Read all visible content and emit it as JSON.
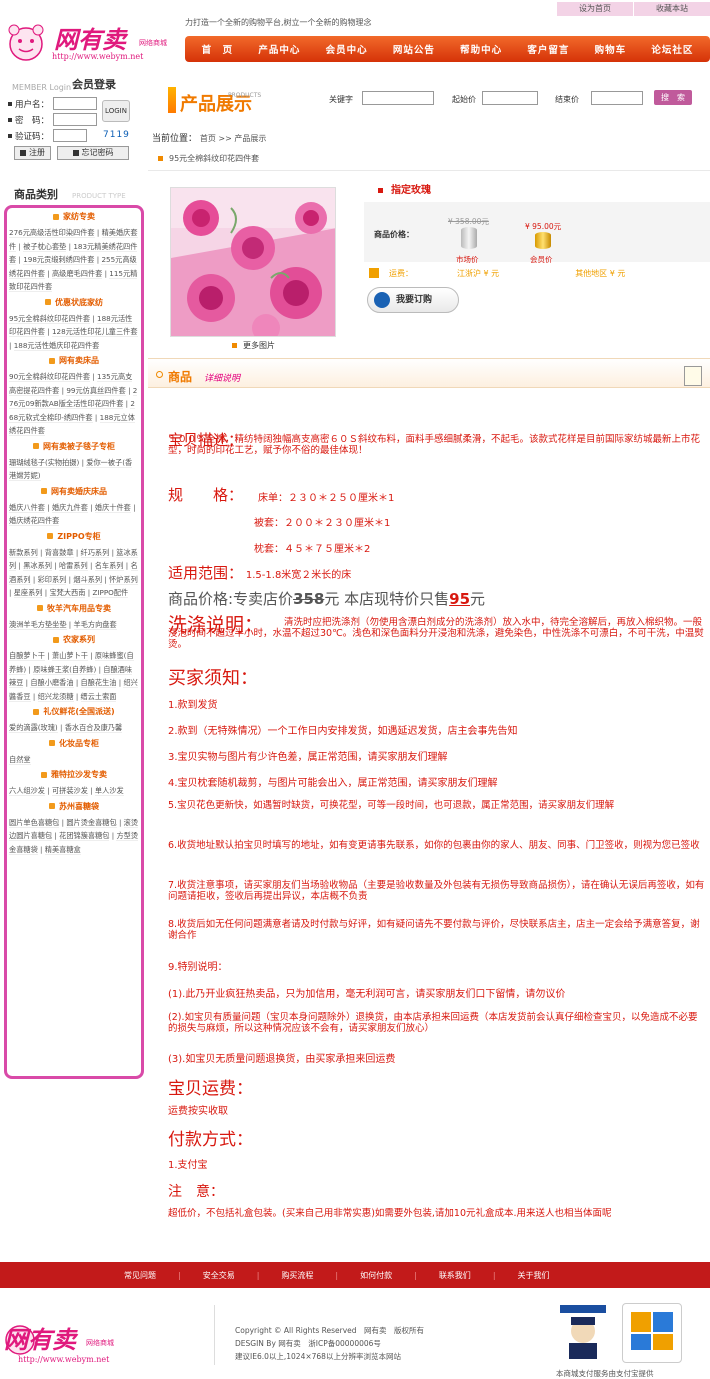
{
  "brand": {
    "name": "网有卖",
    "sub": "网络商城",
    "url": "http://www.webym.net",
    "slogan": "力打造一个全新的购物平台,树立一个全新的购物理念"
  },
  "top_links": [
    "设为首页",
    "收藏本站"
  ],
  "nav": [
    "首　页",
    "产品中心",
    "会员中心",
    "网站公告",
    "帮助中心",
    "客户留言",
    "购物车",
    "论坛社区"
  ],
  "login": {
    "title_en": "MEMBER Login",
    "title": "会员登录",
    "username_label": "用户名：",
    "password_label": "密　码：",
    "captcha_label": "验证码：",
    "captcha_value": "7119",
    "login_button": "LOGIN",
    "register_button": "注册",
    "forgot_button": "忘记密码"
  },
  "categories": {
    "title": "商品类别",
    "title_en": "PRODUCT TYPE",
    "sections": [
      {
        "name": "家纺专卖",
        "items": [
          "276元高级活性印染四件套",
          "精美婚庆套件",
          "被子枕心套垫",
          "183元精美绣花四件套",
          "198元贡缎刺绣四件套",
          "255元高级绣花四件套",
          "高级磨毛四件套",
          "115元精致印花四件套"
        ]
      },
      {
        "name": "优惠状底家纺",
        "items": [
          "95元全棉斜纹印花四件套",
          "188元活性印花四件套",
          "128元活性印花儿童三件套",
          "188元活性婚庆印花四件套"
        ]
      },
      {
        "name": "网有卖床品",
        "items": [
          "90元全棉斜纹印花四件套",
          "135元高支高密提花四件套",
          "99元仿真丝四件套",
          "276元09新款AB版全活性印花四件套",
          "268元软式全棉印-绣四件套",
          "188元立体绣花四件套"
        ]
      },
      {
        "name": "网有卖被子毯子专柜",
        "items": [
          "珊瑚绒毯子(实物拍摄)",
          "爱你一被子(香港嫦芳妮)"
        ]
      },
      {
        "name": "网有卖婚庆床品",
        "items": [
          "婚庆八件套",
          "婚庆九件套",
          "婚庆十件套",
          "婚庆绣花四件套"
        ]
      },
      {
        "name": "ZIPPO专柜",
        "items": [
          "新款系列",
          "背喜鼓章",
          "纤巧系列",
          "篮冰系列",
          "黑冰系列",
          "哈雷系列",
          "名车系列",
          "名酒系列",
          "彩印系列",
          "烟斗系列",
          "怀炉系列",
          "星座系列",
          "宝梵大西南",
          "ZIPPO配件"
        ]
      },
      {
        "name": "牧羊汽车用品专卖",
        "items": [
          "澳洲羊毛方垫坐垫",
          "羊毛方向盘套"
        ]
      },
      {
        "name": "农家系列",
        "items": [
          "自酿萝卜干",
          "萧山萝卜干",
          "原味蜂蜜(自养蜂)",
          "原味蜂王浆(自养蜂)",
          "自酿酒味辣豆",
          "自酿小磨香油",
          "自酿花生油",
          "绍兴醬香豆",
          "绍兴龙须糖",
          "缙云土索面"
        ]
      },
      {
        "name": "礼仪鲜花(全国派送)",
        "items": [
          "爱的滴露(玫瑰)",
          "香水百合及康乃馨"
        ]
      },
      {
        "name": "化妆品专柜",
        "items": [
          "自然堂"
        ]
      },
      {
        "name": "雅特拉沙发专卖",
        "items": [
          "六人组沙发",
          "可拼装沙发",
          "单人沙发"
        ]
      },
      {
        "name": "苏州喜糖袋",
        "items": [
          "圆片单色喜糖包",
          "圆片烫金喜糖包",
          "滚烫边圆片喜糖包",
          "花团锦簇喜糖包",
          "方型烫金喜糖袋",
          "精美喜糖盒"
        ]
      }
    ]
  },
  "product_header": {
    "title": "产品展示",
    "title_en": "PRODUCTS",
    "keyword_label": "关键字",
    "start_price_label": "起始价",
    "end_price_label": "结束价",
    "search_button": "搜　索"
  },
  "breadcrumb": {
    "label": "当前位置：",
    "path": "首页 >> 产品展示"
  },
  "product": {
    "name": "95元全棉斜纹印花四件套",
    "more_pics": "更多图片",
    "custom_title": "指定玫瑰",
    "price_label": "商品价格：",
    "market_price": "¥ 358.00元",
    "market_label": "市场价",
    "member_price": "¥ 95.00元",
    "member_label": "会员价",
    "ship_label": "运费：",
    "ship_local": "江浙沪 ¥ 元",
    "ship_other": "其他地区 ¥ 元",
    "order_button": "我要订购"
  },
  "detail_header": {
    "title": "商品",
    "sub": "详细说明"
  },
  "description": {
    "desc_title": "宝贝描述：",
    "desc_text": "１００％全棉，精纺特阔独幅高支高密６０Ｓ斜纹布料，面料手感细腻柔滑，不起毛。该款式花样是目前国际家纺城最新上市花型，时尚的印花工艺，赋予你不俗的最佳体现！",
    "spec_label": "规　　格：",
    "spec_lines": [
      "床单：２３０＊２５０厘米＊1",
      "被套：２００＊２３０厘米＊1",
      "枕套：４５＊７５厘米＊2"
    ],
    "scope_label": "适用范围：",
    "scope_text": "1.5-1.8米宽２米长的床",
    "price_line_pre": "商品价格:专卖店价",
    "price_line_old": "358",
    "price_line_mid": "元 本店现特价只售",
    "price_line_new": "95",
    "price_line_end": "元",
    "wash_title": "洗涤说明：",
    "wash_text": "清洗时应把洗涤剂（勿使用含漂白剂成分的洗涤剂）放入水中，待完全溶解后，再放入棉织物。一般浸泡时间不超过半小时，水温不超过30℃。浅色和深色面料分开浸泡和洗涤，避免染色，中性洗涤不可漂白，不可干洗，中温熨烫。",
    "buyer_title": "买家须知：",
    "buyer_items": [
      "1.款到发货",
      "2.款到（无特殊情况）一个工作日内安排发货，如遇延迟发货，店主会事先告知",
      "3.宝贝实物与图片有少许色差，属正常范围，请买家朋友们理解",
      "4.宝贝枕套随机裁剪，与图片可能会出入，属正常范围，请买家朋友们理解",
      "5.宝贝花色更新快，如遇暂时缺货，可换花型，可等一段时间，也可退款，属正常范围，请买家朋友们理解",
      "6.收货地址默认拍宝贝时填写的地址，如有变更请事先联系，如你的包裹由你的家人、朋友、同事、门卫签收，则视为您已签收",
      "7.收货注意事项，请买家朋友们当场验收物品（主要是验收数量及外包装有无损伤导致商品损伤），请在确认无误后再签收，如有问题请拒收，签收后再提出异议，本店概不负责",
      "8.收货后如无任何问题满意者请及时付款与好评，如有疑问请先不要付款与评价，尽快联系店主，店主一定会给予满意答复，谢谢合作",
      "9.特别说明："
    ],
    "special_items": [
      "(1).此乃开业疯狂热卖品，只为加信用，毫无利润可言，请买家朋友们口下留情，请勿议价",
      "(2).如宝贝有质量问题（宝贝本身问题除外）退换货，由本店承担来回运费（本店发货前会认真仔细检查宝贝，以免造成不必要的损失与麻烦，所以这种情况应该不会有，请买家朋友们放心）",
      "(3).如宝贝无质量问题退换货，由买家承担来回运费"
    ],
    "ship_title": "宝贝运费：",
    "ship_text": "运费按实收取",
    "pay_title": "付款方式：",
    "pay_text": "1.支付宝",
    "note_title": "注　意：",
    "note_text": "超低价，不包括礼盒包装。(买来自己用非常实惠)如需要外包装,请加10元礼盒成本.用来送人也相当体面呢"
  },
  "footer": {
    "links": [
      "常见问题",
      "安全交易",
      "购买流程",
      "如何付款",
      "联系我们",
      "关于我们"
    ],
    "copyright": "Copyright © All Rights Reserved　网有卖　版权所有",
    "design": "DESGIN By 网有卖　浙ICP备00000006号",
    "advice": "建议IE6.0以上,1024×768以上分辨率浏览本网站",
    "alipay_note": "本商城支付服务由支付宝提供"
  },
  "colors": {
    "accent": "#d8180f",
    "nav": "#e24a15",
    "brand": "#e0197d",
    "border": "#d94aa8"
  }
}
